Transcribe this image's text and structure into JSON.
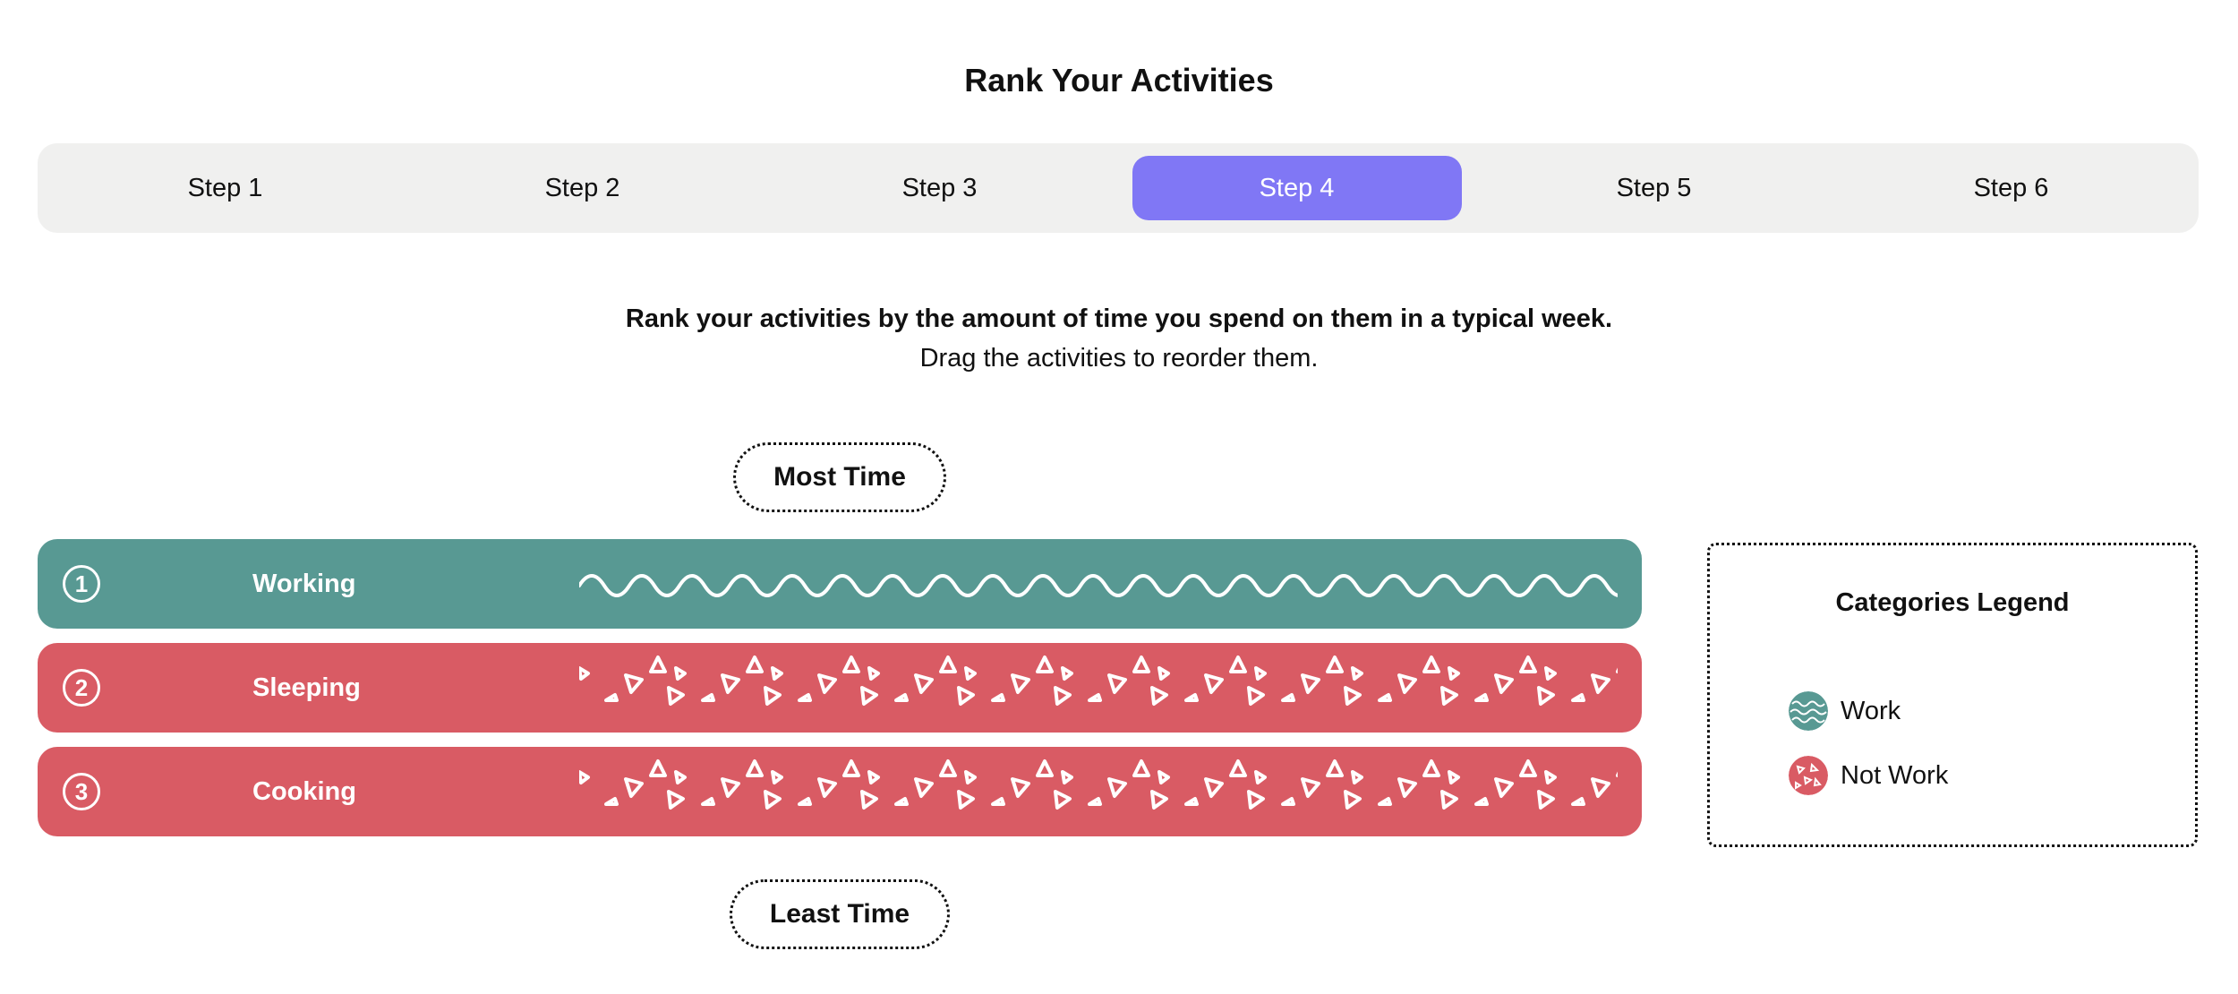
{
  "page": {
    "title": "Rank Your Activities"
  },
  "stepper": {
    "steps": [
      {
        "label": "Step 1",
        "active": false
      },
      {
        "label": "Step 2",
        "active": false
      },
      {
        "label": "Step 3",
        "active": false
      },
      {
        "label": "Step 4",
        "active": true
      },
      {
        "label": "Step 5",
        "active": false
      },
      {
        "label": "Step 6",
        "active": false
      }
    ],
    "active_color": "#8077f5"
  },
  "instructions": {
    "main": "Rank your activities by the amount of time you spend on them in a typical week.",
    "sub": "Drag the activities to reorder them."
  },
  "markers": {
    "top": "Most Time",
    "bottom": "Least Time"
  },
  "activities": [
    {
      "rank": "1",
      "label": "Working",
      "category": "Work",
      "pattern": "wave-pattern"
    },
    {
      "rank": "2",
      "label": "Sleeping",
      "category": "Not Work",
      "pattern": "triangle-pattern"
    },
    {
      "rank": "3",
      "label": "Cooking",
      "category": "Not Work",
      "pattern": "triangle-pattern"
    }
  ],
  "legend": {
    "title": "Categories Legend",
    "items": [
      {
        "label": "Work",
        "color": "#589993",
        "icon": "wave-pattern-icon"
      },
      {
        "label": "Not Work",
        "color": "#d95b64",
        "icon": "triangle-pattern-icon"
      }
    ]
  },
  "colors": {
    "work": "#589993",
    "not_work": "#d95b64"
  }
}
